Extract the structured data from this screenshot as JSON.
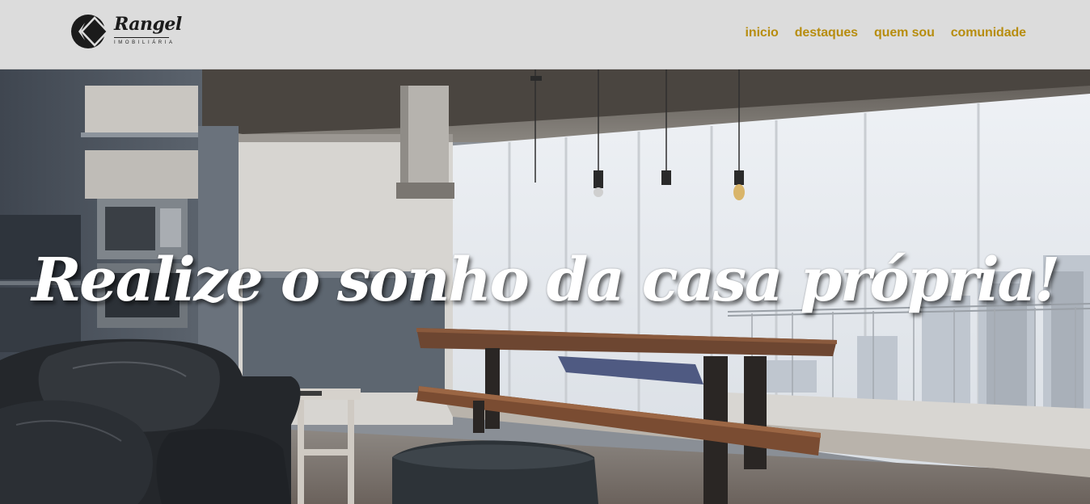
{
  "brand": {
    "name": "Rangel",
    "subtitle": "IMOBILIÁRIA",
    "logo_icon": "diamond-chevron-logo-icon"
  },
  "nav": {
    "items": [
      {
        "label": "inicio"
      },
      {
        "label": "destaques"
      },
      {
        "label": "quem sou"
      },
      {
        "label": "comunidade"
      }
    ]
  },
  "hero": {
    "title": "Realize o sonho da casa própria!",
    "image": "apartment-living-room-photo"
  },
  "colors": {
    "header_bg": "#dcdcdc",
    "nav_link": "#b78d0f",
    "logo": "#1b1b1b",
    "hero_title": "#ffffff"
  }
}
